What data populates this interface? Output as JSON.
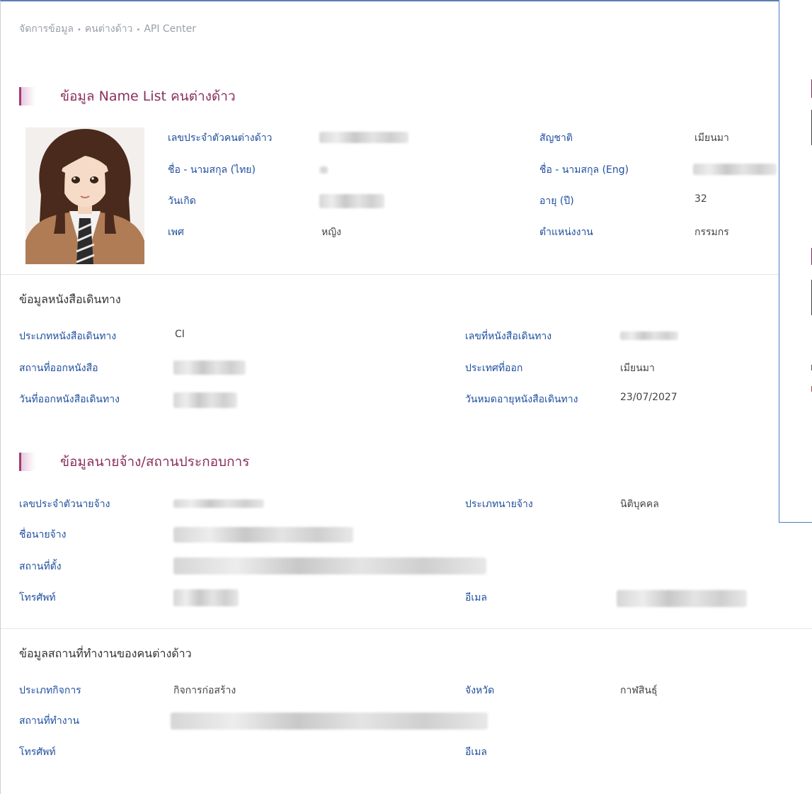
{
  "breadcrumb": {
    "item1": "จัดการข้อมูล",
    "item2": "คนต่างด้าว",
    "item3": "API Center",
    "separator": "•"
  },
  "profile": {
    "title": "ข้อมูล Name List คนต่างด้าว",
    "fields": {
      "id_label": "เลขประจำตัวคนต่างด้าว",
      "name_th_label": "ชื่อ - นามสกุล (ไทย)",
      "dob_label": "วันเกิด",
      "gender_label": "เพศ",
      "gender_value": "หญิง",
      "nationality_label": "สัญชาติ",
      "nationality_value": "เมียนมา",
      "name_en_label": "ชื่อ - นามสกุล (Eng)",
      "age_label": "อายุ (ปี)",
      "age_value": "32",
      "position_label": "ตำแหน่งงาน",
      "position_value": "กรรมกร"
    }
  },
  "passport": {
    "title": "ข้อมูลหนังสือเดินทาง",
    "type_label": "ประเภทหนังสือเดินทาง",
    "type_value": "CI",
    "issue_place_label": "สถานที่ออกหนังสือ",
    "issue_date_label": "วันที่ออกหนังสือเดินทาง",
    "number_label": "เลขที่หนังสือเดินทาง",
    "issue_country_label": "ประเทศที่ออก",
    "issue_country_value": "เมียนมา",
    "expiry_label": "วันหมดอายุหนังสือเดินทาง",
    "expiry_value": "23/07/2027"
  },
  "employer": {
    "title": "ข้อมูลนายจ้าง/สถานประกอบการ",
    "id_label": "เลขประจำตัวนายจ้าง",
    "name_label": "ชื่อนายจ้าง",
    "address_label": "สถานที่ตั้ง",
    "phone_label": "โทรศัพท์",
    "type_label": "ประเภทนายจ้าง",
    "type_value": "นิติบุคคล",
    "email_label": "อีเมล"
  },
  "workplace": {
    "title": "ข้อมูลสถานที่ทำงานของคนต่างด้าว",
    "business_type_label": "ประเภทกิจการ",
    "business_type_value": "กิจการก่อสร้าง",
    "location_label": "สถานที่ทำงาน",
    "phone_label": "โทรศัพท์",
    "province_label": "จังหวัด",
    "province_value": "กาฬสินธุ์",
    "email_label": "อีเมล"
  }
}
